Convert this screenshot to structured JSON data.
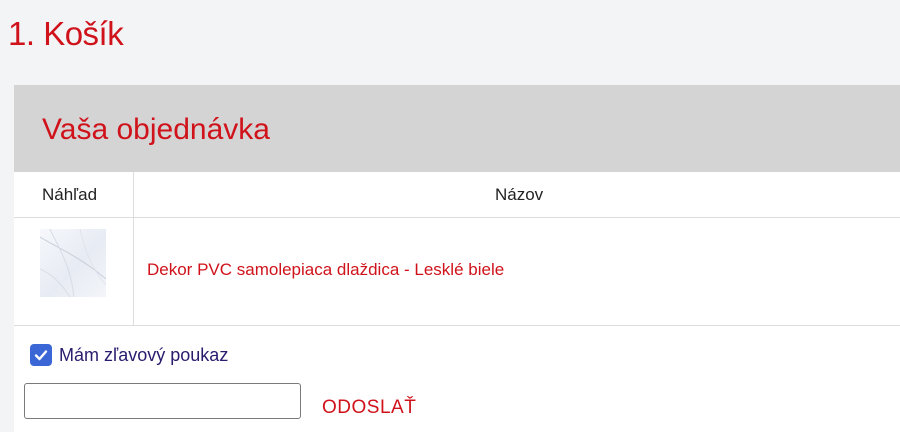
{
  "page": {
    "title": "1. Košík"
  },
  "order": {
    "title": "Vaša objednávka",
    "columns": {
      "preview": "Náhľad",
      "name": "Názov"
    },
    "items": [
      {
        "name": "Dekor PVC samolepiaca dlaždica - Lesklé biele",
        "thumbnail_icon": "marble-tile-image"
      }
    ]
  },
  "voucher": {
    "checkbox_label": "Mám zľavový poukaz",
    "checked": true,
    "input_value": "",
    "input_placeholder": "",
    "submit_label": "ODOSLAŤ"
  },
  "colors": {
    "accent": "#d0121b",
    "header_bg": "#d4d4d4",
    "page_bg": "#f3f4f6",
    "checkbox": "#3b67d6",
    "checkbox_label": "#2a1b6e"
  }
}
